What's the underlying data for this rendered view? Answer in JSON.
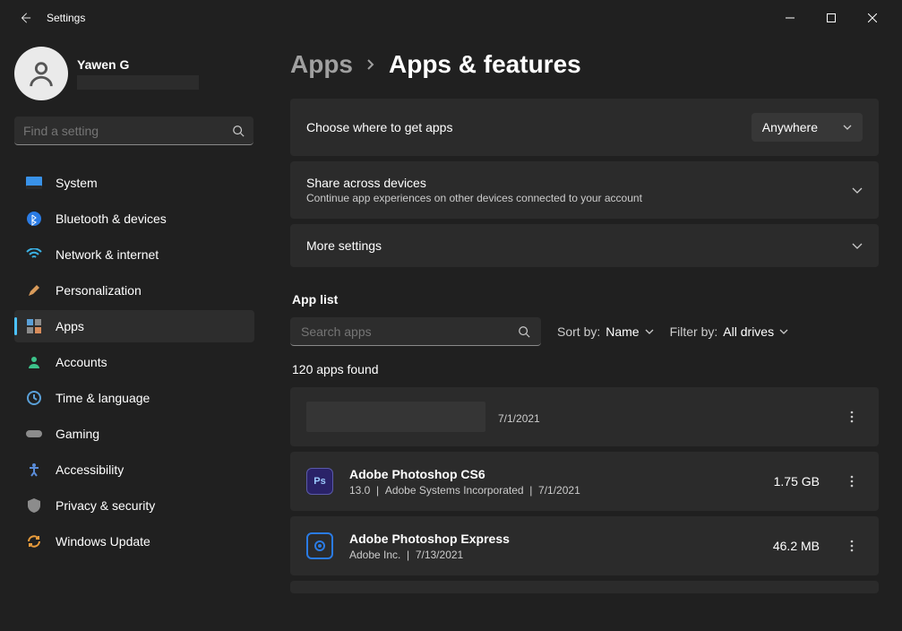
{
  "titlebar": {
    "title": "Settings"
  },
  "profile": {
    "name": "Yawen G"
  },
  "search": {
    "placeholder": "Find a setting"
  },
  "nav": [
    {
      "label": "System"
    },
    {
      "label": "Bluetooth & devices"
    },
    {
      "label": "Network & internet"
    },
    {
      "label": "Personalization"
    },
    {
      "label": "Apps"
    },
    {
      "label": "Accounts"
    },
    {
      "label": "Time & language"
    },
    {
      "label": "Gaming"
    },
    {
      "label": "Accessibility"
    },
    {
      "label": "Privacy & security"
    },
    {
      "label": "Windows Update"
    }
  ],
  "breadcrumb": {
    "root": "Apps",
    "leaf": "Apps & features"
  },
  "cards": {
    "source": {
      "title": "Choose where to get apps",
      "value": "Anywhere"
    },
    "share": {
      "title": "Share across devices",
      "desc": "Continue app experiences on other devices connected to your account"
    },
    "more": {
      "title": "More settings"
    }
  },
  "applist": {
    "label": "App list",
    "search_placeholder": "Search apps",
    "sort_label": "Sort by:",
    "sort_value": "Name",
    "filter_label": "Filter by:",
    "filter_value": "All drives",
    "count": "120 apps found"
  },
  "apps": [
    {
      "name": "",
      "meta_date": "7/1/2021",
      "size": ""
    },
    {
      "name": "Adobe Photoshop CS6",
      "version": "13.0",
      "publisher": "Adobe Systems Incorporated",
      "date": "7/1/2021",
      "size": "1.75 GB"
    },
    {
      "name": "Adobe Photoshop Express",
      "publisher": "Adobe Inc.",
      "date": "7/13/2021",
      "size": "46.2 MB"
    }
  ]
}
